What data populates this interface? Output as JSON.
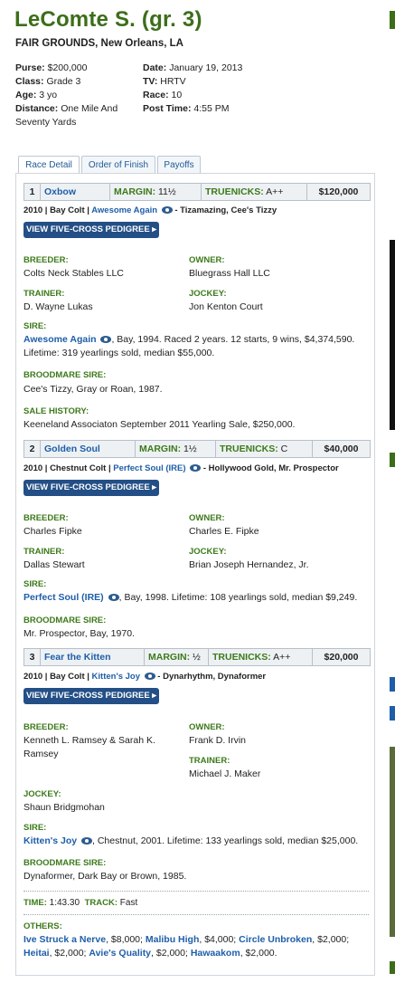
{
  "title": "LeComte S. (gr. 3)",
  "venue": "FAIR GROUNDS, New Orleans, LA",
  "info_left": [
    {
      "label": "Purse:",
      "value": "$200,000"
    },
    {
      "label": "Class:",
      "value": "Grade 3"
    },
    {
      "label": "Age:",
      "value": "3 yo"
    },
    {
      "label": "Distance:",
      "value": "One Mile And Seventy Yards"
    }
  ],
  "info_right": [
    {
      "label": "Date:",
      "value": "January 19, 2013"
    },
    {
      "label": "TV:",
      "value": "HRTV"
    },
    {
      "label": "Race:",
      "value": "10"
    },
    {
      "label": "Post Time:",
      "value": "4:55 PM"
    }
  ],
  "tabs": [
    "Race Detail",
    "Order of Finish",
    "Payoffs"
  ],
  "active_tab": "Race Detail",
  "labels": {
    "margin": "MARGIN:",
    "truenicks": "TRUENICKS:",
    "pedigree_button": "VIEW FIVE-CROSS PEDIGREE ▸",
    "breeder": "BREEDER:",
    "owner": "OWNER:",
    "trainer": "TRAINER:",
    "jockey": "JOCKEY:",
    "sire": "SIRE:",
    "broodmare_sire": "BROODMARE SIRE:",
    "sale_history": "SALE HISTORY:",
    "time": "TIME:",
    "track": "TRACK:",
    "others": "OTHERS:"
  },
  "horses": [
    {
      "pos": "1",
      "name": "Oxbow",
      "margin": "11½",
      "truenicks": "A++",
      "earnings": "$120,000",
      "breeding_prefix": "2010 | Bay Colt |",
      "breeding_sire": "Awesome Again",
      "breeding_suffix": "- Tizamazing, Cee's Tizzy",
      "breeder": "Colts Neck Stables LLC",
      "owner": "Bluegrass Hall LLC",
      "trainer": "D. Wayne Lukas",
      "jockey": "Jon Kenton Court",
      "sire_name": "Awesome Again",
      "sire_desc": ", Bay, 1994. Raced 2 years. 12 starts, 9 wins, $4,374,590. Lifetime: 319 yearlings sold, median $55,000.",
      "broodmare_sire": "Cee's Tizzy, Gray or Roan, 1987.",
      "sale_history": "Keeneland Associaton September 2011 Yearling Sale, $250,000."
    },
    {
      "pos": "2",
      "name": "Golden Soul",
      "margin": "1½",
      "truenicks": "C",
      "earnings": "$40,000",
      "breeding_prefix": "2010 | Chestnut Colt |",
      "breeding_sire": "Perfect Soul (IRE)",
      "breeding_suffix": "- Hollywood Gold, Mr. Prospector",
      "breeder": "Charles Fipke",
      "owner": "Charles E. Fipke",
      "trainer": "Dallas Stewart",
      "jockey": "Brian Joseph Hernandez, Jr.",
      "sire_name": "Perfect Soul (IRE)",
      "sire_desc": ", Bay, 1998. Lifetime: 108 yearlings sold, median $9,249.",
      "broodmare_sire": "Mr. Prospector, Bay, 1970."
    },
    {
      "pos": "3",
      "name": "Fear the Kitten",
      "margin": "½",
      "truenicks": "A++",
      "earnings": "$20,000",
      "breeding_prefix": "2010 | Bay Colt |",
      "breeding_sire": "Kitten's Joy",
      "breeding_suffix": "- Dynarhythm, Dynaformer",
      "breeder": "Kenneth L. Ramsey & Sarah K. Ramsey",
      "owner": "Frank D. Irvin",
      "trainer": "Michael J. Maker",
      "jockey": "Shaun Bridgmohan",
      "sire_name": "Kitten's Joy",
      "sire_desc": ", Chestnut, 2001. Lifetime: 133 yearlings sold, median $25,000.",
      "broodmare_sire": "Dynaformer, Dark Bay or Brown, 1985."
    }
  ],
  "time_value": "1:43.30",
  "track_value": "Fast",
  "others": [
    {
      "name": "Ive Struck a Nerve",
      "amount": ", $8,000;"
    },
    {
      "name": "Malibu High",
      "amount": ", $4,000;"
    },
    {
      "name": "Circle Unbroken",
      "amount": ", $2,000;"
    },
    {
      "name": "Heitai",
      "amount": ", $2,000;"
    },
    {
      "name": "Avie's Quality",
      "amount": ", $2,000;"
    },
    {
      "name": "Hawaakom",
      "amount": ", $2,000."
    }
  ]
}
